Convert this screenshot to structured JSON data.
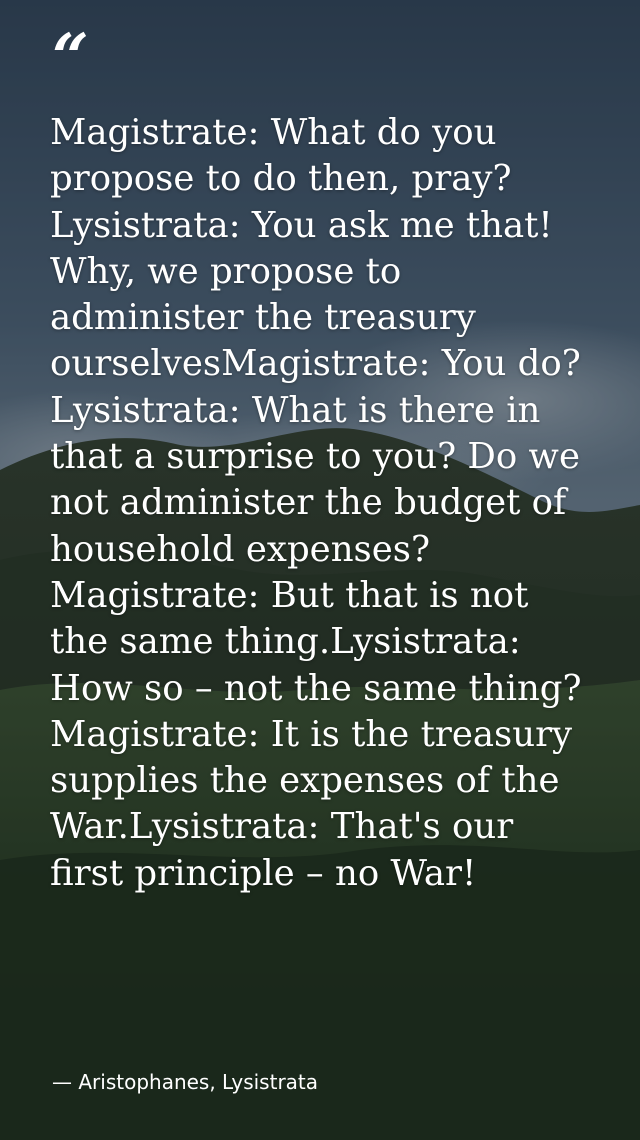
{
  "quote": {
    "mark": "“",
    "text": "Magistrate: What do you propose to do then, pray?Lysistrata: You ask me that! Why, we propose to administer the treasury ourselvesMagistrate: You do?Lysistrata: What is there in that a surprise to you? Do we not administer the budget of household expenses?Magistrate: But that is not the same thing.Lysistrata: How so – not the same thing?Magistrate: It is the treasury supplies the expenses of the War.Lysistrata: That's our first principle – no War!",
    "attribution": "— Aristophanes, Lysistrata"
  },
  "colors": {
    "text": "#ffffff",
    "sky_top": "#3b4d60",
    "sky_mid": "#5d7285",
    "cloud": "#8a98a4",
    "hills": "#2f3b2d",
    "foreground": "#253520"
  }
}
